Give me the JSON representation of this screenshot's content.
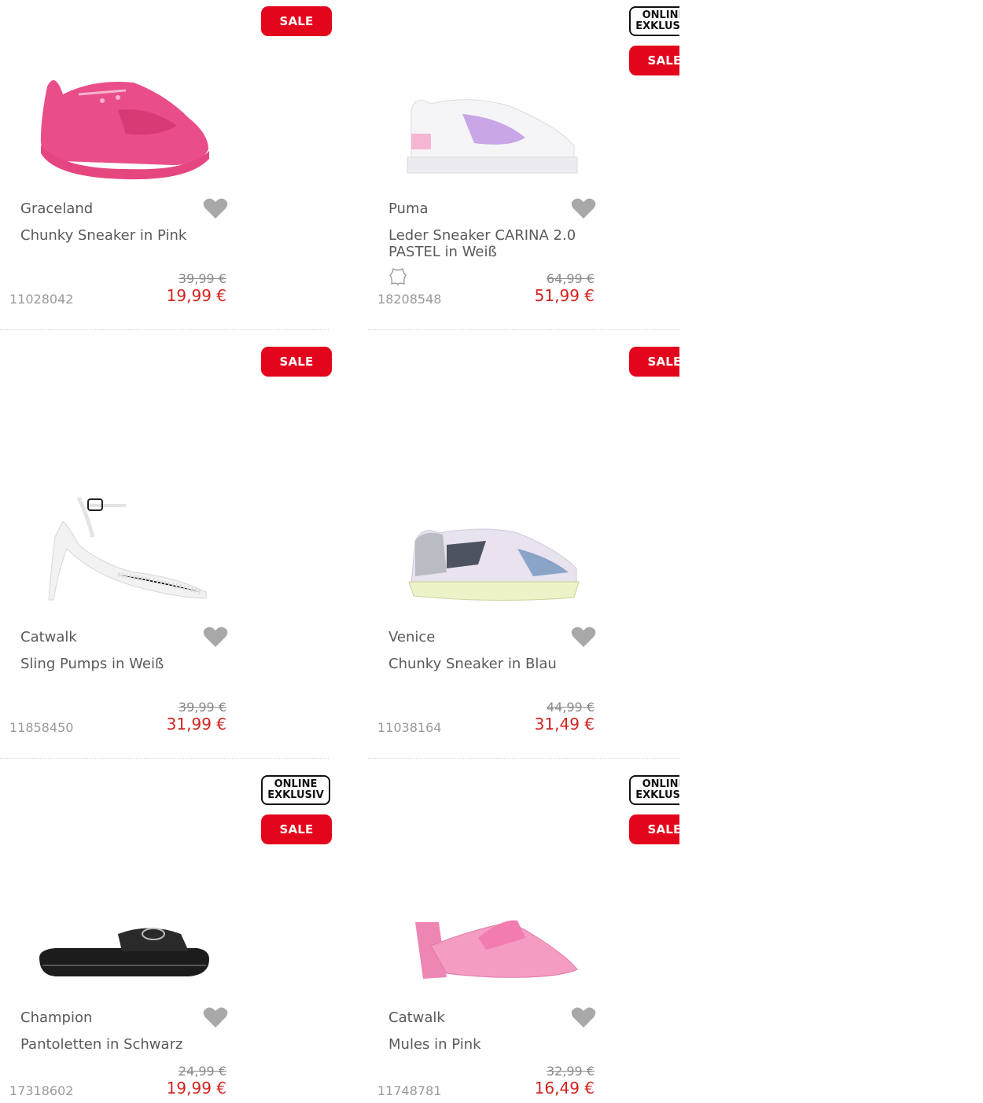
{
  "badges": {
    "sale": "SALE",
    "online_line1": "ONLINE",
    "online_line2": "EXKLUSIV"
  },
  "colors": {
    "sale_red": "#e3051b",
    "price_red": "#d2231e",
    "text_grey": "#5a5a5a",
    "heart_grey": "#a8a8a8"
  },
  "products": [
    {
      "brand": "Graceland",
      "title": "Chunky Sneaker in Pink",
      "old_price": "39,99 €",
      "new_price": "19,99 €",
      "sku": "11028042",
      "icon": "pink-chunky-sneaker"
    },
    {
      "brand": "Puma",
      "title": "Leder Sneaker CARINA 2.0 PASTEL in Weiß",
      "old_price": "64,99 €",
      "new_price": "51,99 €",
      "sku": "18208548",
      "icon": "white-lilac-sneaker"
    },
    {
      "brand": "Catwalk",
      "title": "Sling Pumps in Weiß",
      "old_price": "39,99 €",
      "new_price": "31,99 €",
      "sku": "11858450",
      "icon": "white-sling-pump"
    },
    {
      "brand": "Venice",
      "title": "Chunky Sneaker in Blau",
      "old_price": "44,99 €",
      "new_price": "31,49 €",
      "sku": "11038164",
      "icon": "blue-chunky-sneaker"
    },
    {
      "brand": "Champion",
      "title": "Pantoletten in Schwarz",
      "old_price": "24,99 €",
      "new_price": "19,99 €",
      "sku": "17318602",
      "icon": "black-slide"
    },
    {
      "brand": "Catwalk",
      "title": "Mules in Pink",
      "old_price": "32,99 €",
      "new_price": "16,49 €",
      "sku": "11748781",
      "icon": "pink-mule"
    }
  ]
}
